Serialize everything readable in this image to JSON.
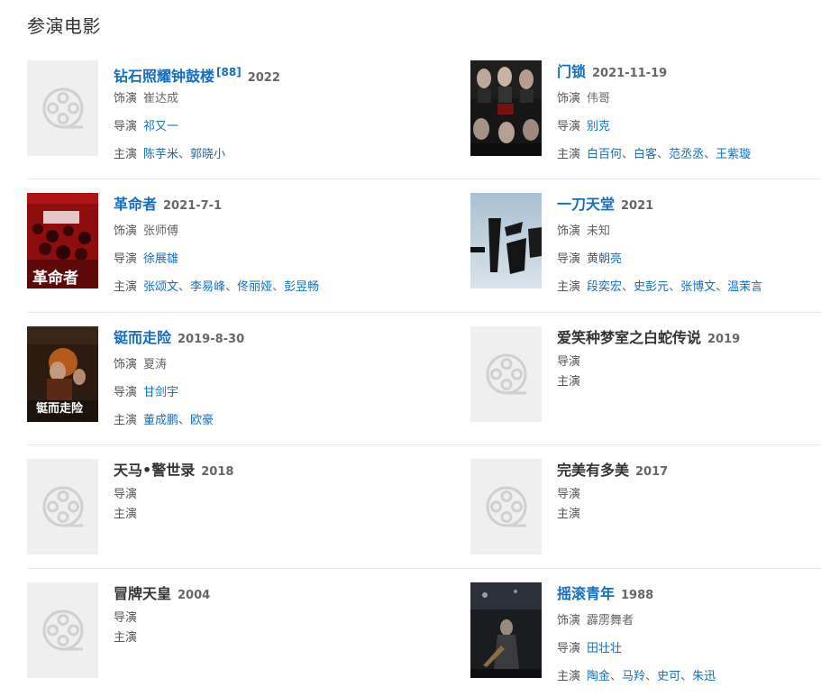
{
  "section": {
    "title": "参演电影"
  },
  "films": [
    {
      "title": "钻石照耀钟鼓楼",
      "ref": "[88]",
      "year": "2022",
      "has_poster": false,
      "linked": true,
      "role_label": "饰演",
      "role": "崔达成",
      "director_label": "导演",
      "director": "祁又一",
      "cast_label": "主演",
      "cast": [
        "陈芋米",
        "郭晓小"
      ],
      "cast_sep": "、"
    },
    {
      "title": "门锁",
      "year": "2021-11-19",
      "has_poster": true,
      "poster_theme": "dark-horror",
      "linked": true,
      "role_label": "饰演",
      "role": "伟哥",
      "director_label": "导演",
      "director": "别克",
      "cast_label": "主演",
      "cast": [
        "白百何",
        "白客",
        "范丞丞",
        "王紫璇"
      ],
      "cast_sep": "、"
    },
    {
      "title": "革命者",
      "year": "2021-7-1",
      "has_poster": true,
      "poster_theme": "red-crowd",
      "poster_text": "革命者",
      "linked": true,
      "role_label": "饰演",
      "role": "张师傅",
      "director_label": "导演",
      "director": "徐展雄",
      "cast_label": "主演",
      "cast": [
        "张颂文",
        "李易峰",
        "佟丽娅",
        "彭昱畅"
      ],
      "cast_sep": "、"
    },
    {
      "title": "一刀天堂",
      "year": "2021",
      "has_poster": true,
      "poster_theme": "calligraphy",
      "poster_text": "一刀天堂",
      "linked": true,
      "role_label": "饰演",
      "role": "未知",
      "director_label": "导演",
      "director": "黄朝亮",
      "cast_label": "主演",
      "cast": [
        "段奕宏",
        "史彭元",
        "张博文",
        "温茉言"
      ],
      "cast_sep": "、"
    },
    {
      "title": "铤而走险",
      "year": "2019-8-30",
      "has_poster": true,
      "poster_theme": "action",
      "poster_text": "铤而走险",
      "linked": true,
      "role_label": "饰演",
      "role": "夏涛",
      "director_label": "导演",
      "director": "甘剑宇",
      "cast_label": "主演",
      "cast": [
        "董成鹏",
        "欧豪"
      ],
      "cast_sep": "、"
    },
    {
      "title": "爱笑种梦室之白蛇传说",
      "year": "2019",
      "has_poster": false,
      "linked": false,
      "director_label": "导演",
      "cast_label": "主演"
    },
    {
      "title": "天马•警世录",
      "year": "2018",
      "has_poster": false,
      "linked": false,
      "director_label": "导演",
      "cast_label": "主演"
    },
    {
      "title": "完美有多美",
      "year": "2017",
      "has_poster": false,
      "linked": false,
      "director_label": "导演",
      "cast_label": "主演"
    },
    {
      "title": "冒牌天皇",
      "year": "2004",
      "has_poster": false,
      "linked": false,
      "director_label": "导演",
      "cast_label": "主演"
    },
    {
      "title": "摇滚青年",
      "year": "1988",
      "has_poster": true,
      "poster_theme": "rock-stage",
      "linked": true,
      "role_label": "饰演",
      "role": "霹雳舞者",
      "director_label": "导演",
      "director": "田壮壮",
      "cast_label": "主演",
      "cast": [
        "陶金",
        "马羚",
        "史可",
        "朱迅"
      ],
      "cast_sep": "、"
    }
  ],
  "colors": {
    "link": "#136ec2",
    "placeholder_bg": "#efefef",
    "divider": "#e6e6e6"
  }
}
